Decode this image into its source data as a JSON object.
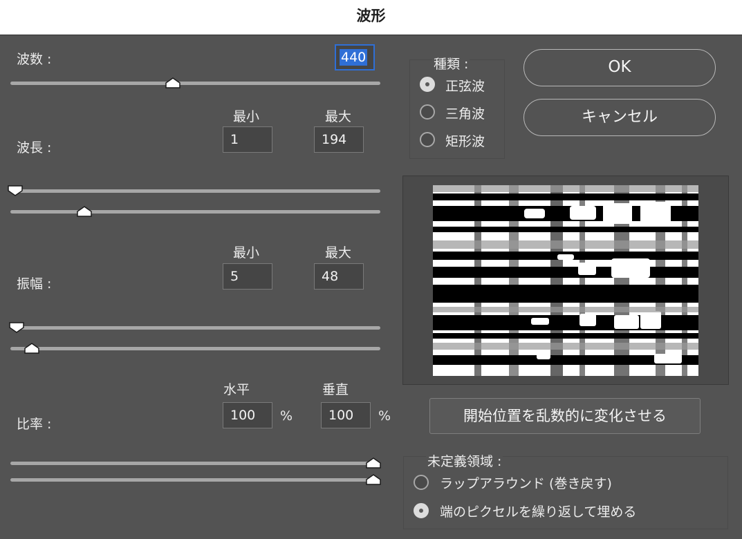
{
  "dialog": {
    "title": "波形"
  },
  "generators": {
    "label": "波数 :",
    "value": "440",
    "slider_level": 0.44
  },
  "wavelength": {
    "label": "波長 :",
    "min_label": "最小",
    "max_label": "最大",
    "min_value": "1",
    "max_value": "194",
    "min_level": 0.0,
    "max_level": 0.2
  },
  "amplitude": {
    "label": "振幅 :",
    "min_label": "最小",
    "max_label": "最大",
    "min_value": "5",
    "max_value": "48",
    "min_level": 0.0,
    "max_level": 0.06
  },
  "scale": {
    "label": "比率 :",
    "h_label": "水平",
    "v_label": "垂直",
    "h_value": "100",
    "v_value": "100",
    "unit": "%",
    "h_level": 1.0,
    "v_level": 1.0
  },
  "type": {
    "label": "種類 :",
    "options": [
      "正弦波",
      "三角波",
      "矩形波"
    ],
    "selected": "正弦波"
  },
  "buttons": {
    "ok": "OK",
    "cancel": "キャンセル",
    "randomize": "開始位置を乱数的に変化させる"
  },
  "undefined_areas": {
    "label": "未定義領域 :",
    "options": [
      "ラップアラウンド (巻き戻す)",
      "端のピクセルを繰り返して埋める"
    ],
    "selected": "端のピクセルを繰り返して埋める"
  },
  "colors": {
    "accent": "#2f6fd6",
    "panel": "#535353",
    "field": "#454545"
  }
}
